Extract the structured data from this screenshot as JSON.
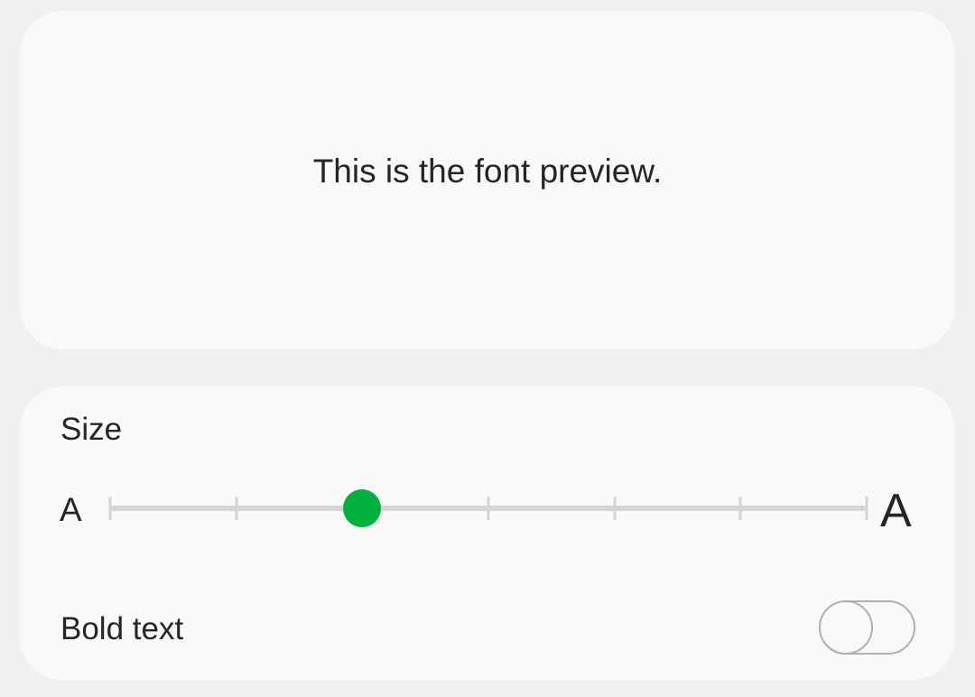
{
  "preview": {
    "text": "This is the font preview."
  },
  "size": {
    "label": "Size",
    "min_label": "A",
    "max_label": "A",
    "steps": 7,
    "selected_step": 2,
    "accent_color": "#00b140"
  },
  "bold_text": {
    "label": "Bold text",
    "enabled": false
  }
}
